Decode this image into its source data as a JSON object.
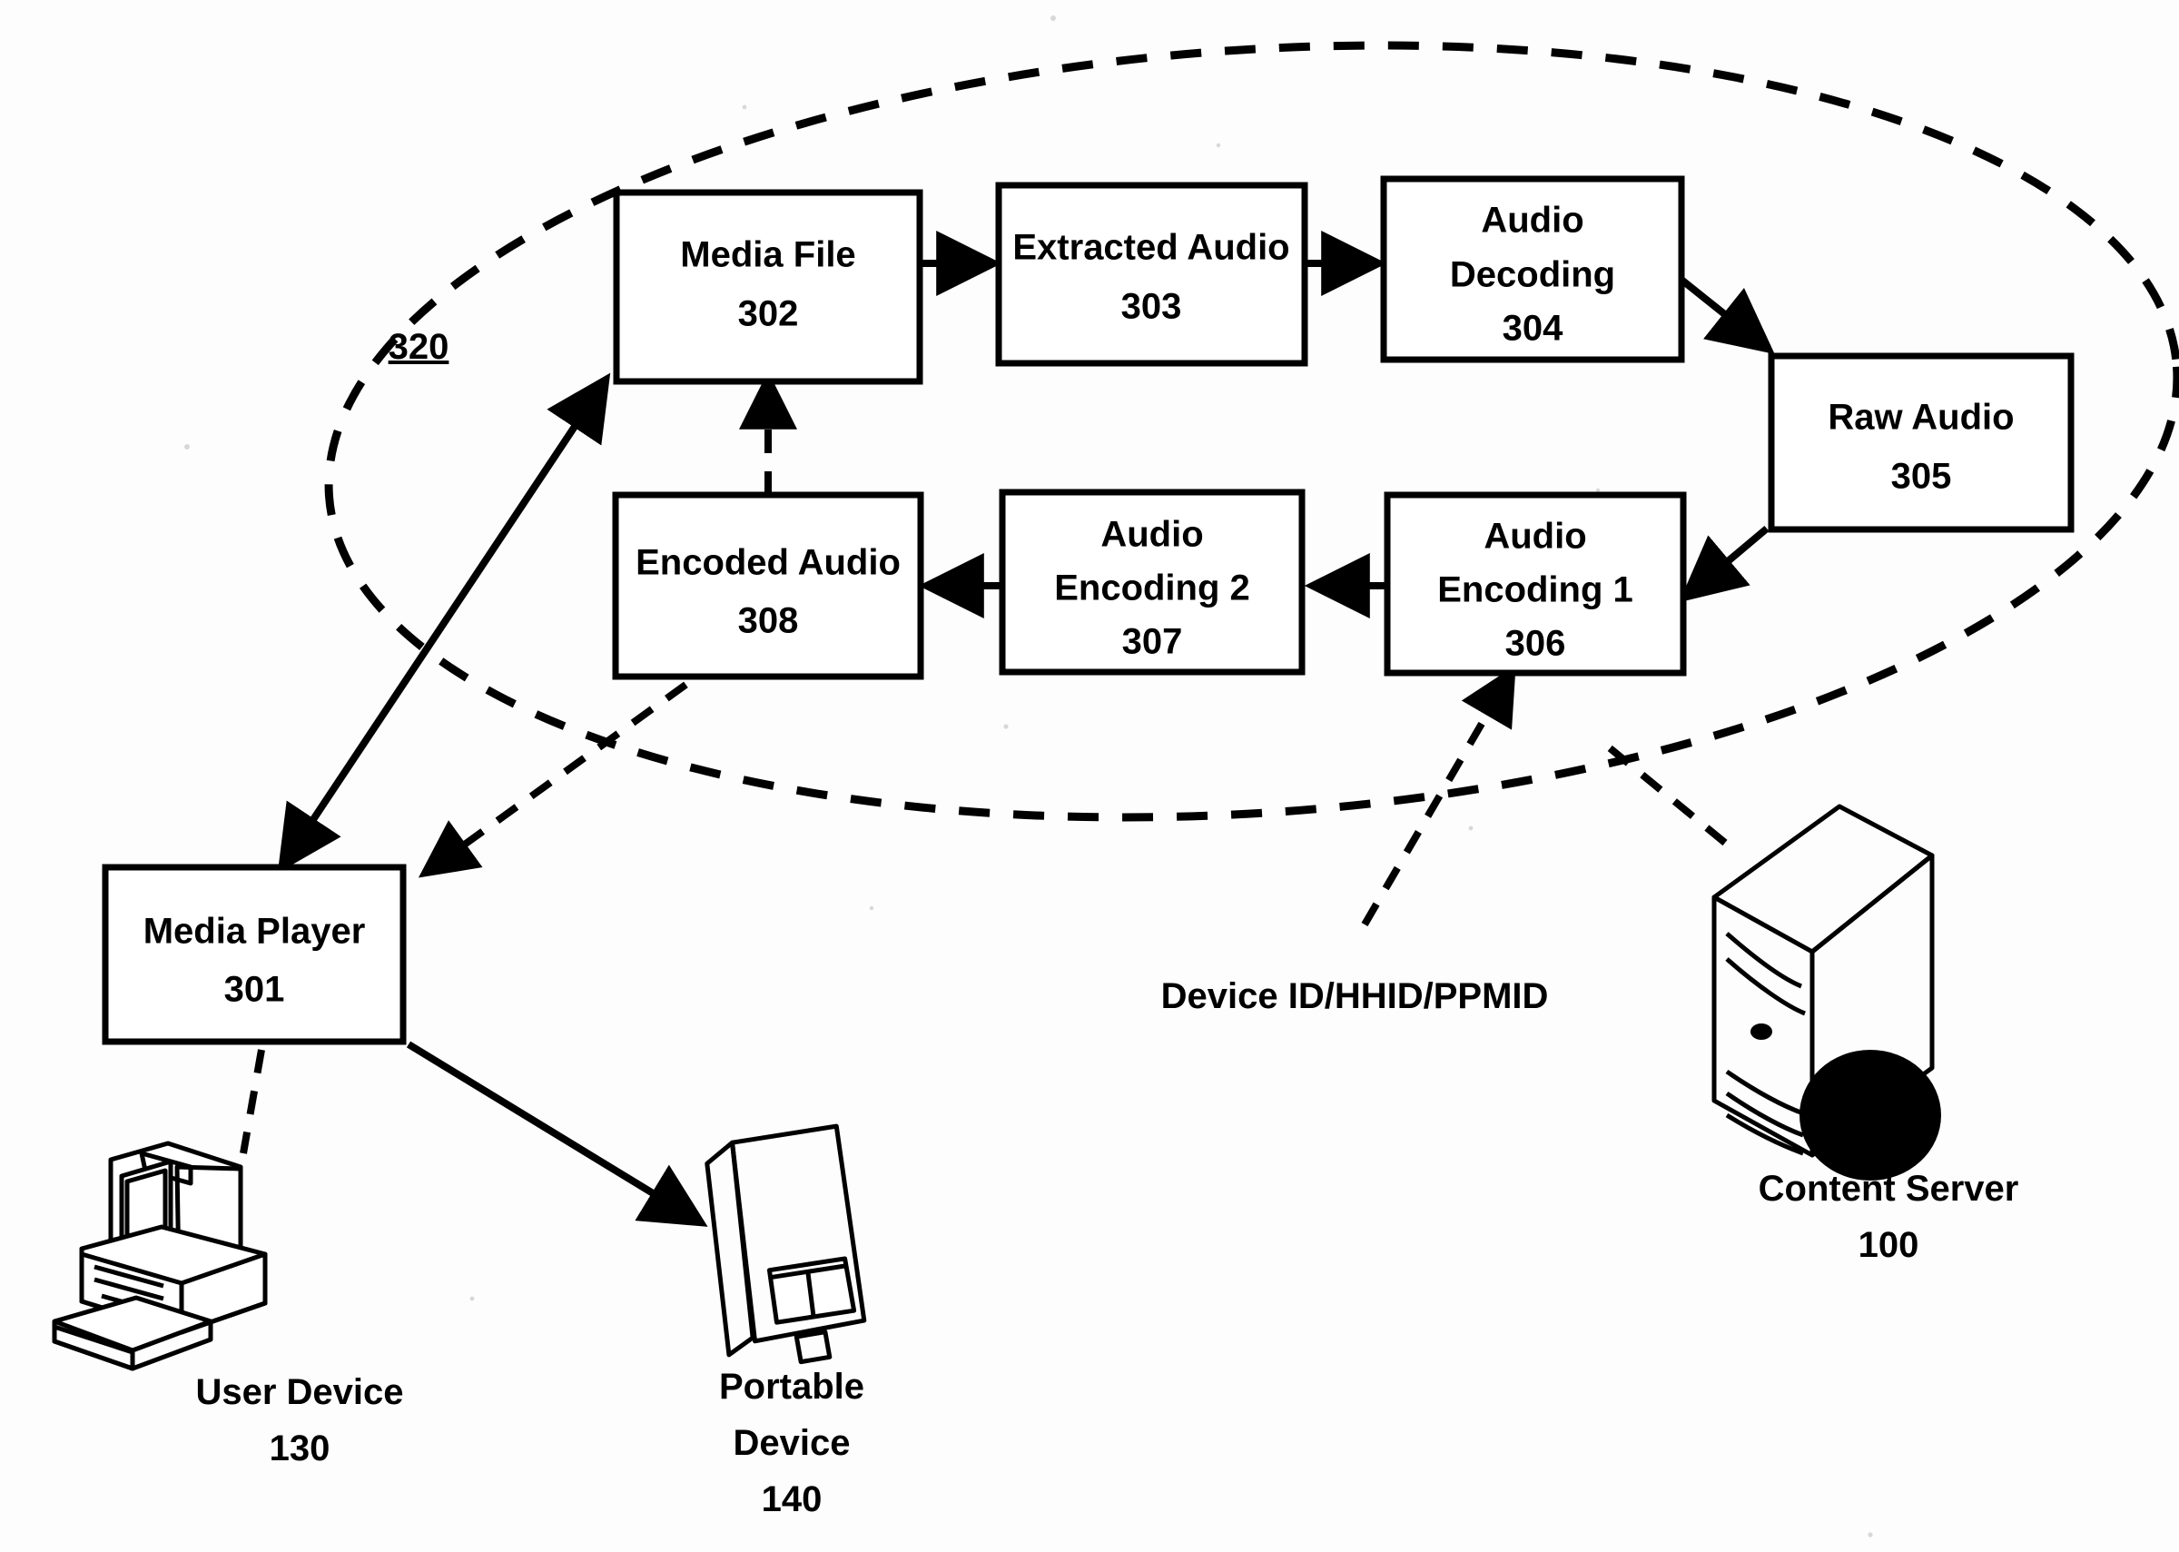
{
  "figure": {
    "type": "patent-flow-diagram",
    "group_label": "320"
  },
  "boxes": [
    {
      "id": "302",
      "lines": [
        "Media File",
        "302"
      ],
      "title": "Media File",
      "number": "302"
    },
    {
      "id": "303",
      "lines": [
        "Extracted Audio",
        "303"
      ],
      "title": "Extracted Audio",
      "number": "303"
    },
    {
      "id": "304",
      "lines": [
        "Audio",
        "Decoding",
        "304"
      ],
      "title": "Audio Decoding",
      "number": "304"
    },
    {
      "id": "305",
      "lines": [
        "Raw Audio",
        "305"
      ],
      "title": "Raw Audio",
      "number": "305"
    },
    {
      "id": "306",
      "lines": [
        "Audio",
        "Encoding 1",
        "306"
      ],
      "title": "Audio Encoding 1",
      "number": "306"
    },
    {
      "id": "307",
      "lines": [
        "Audio",
        "Encoding 2",
        "307"
      ],
      "title": "Audio Encoding 2",
      "number": "307"
    },
    {
      "id": "308",
      "lines": [
        "Encoded Audio",
        "308"
      ],
      "title": "Encoded Audio",
      "number": "308"
    },
    {
      "id": "301",
      "lines": [
        "Media Player",
        "301"
      ],
      "title": "Media Player",
      "number": "301"
    }
  ],
  "box_text": {
    "media_file_title": "Media File",
    "media_file_num": "302",
    "extracted_audio_title": "Extracted Audio",
    "extracted_audio_num": "303",
    "audio_decoding_l1": "Audio",
    "audio_decoding_l2": "Decoding",
    "audio_decoding_num": "304",
    "raw_audio_title": "Raw Audio",
    "raw_audio_num": "305",
    "audio_encoding1_l1": "Audio",
    "audio_encoding1_l2": "Encoding 1",
    "audio_encoding1_num": "306",
    "audio_encoding2_l1": "Audio",
    "audio_encoding2_l2": "Encoding 2",
    "audio_encoding2_num": "307",
    "encoded_audio_title": "Encoded Audio",
    "encoded_audio_num": "308",
    "media_player_title": "Media Player",
    "media_player_num": "301"
  },
  "annotations": {
    "group_ref": "320",
    "device_id_label": "Device ID/HHID/PPMID"
  },
  "devices": [
    {
      "id": "user-device",
      "icon": "desktop-computer-icon",
      "label_line1": "User Device",
      "label_line2": "130"
    },
    {
      "id": "portable-device",
      "icon": "portable-media-player-icon",
      "label_line1": "Portable",
      "label_line2": "Device",
      "label_line3": "140"
    },
    {
      "id": "content-server",
      "icon": "server-tower-icon",
      "label_line1": "Content Server",
      "label_line2": "100"
    }
  ],
  "device_text": {
    "user_device_l1": "User Device",
    "user_device_l2": "130",
    "portable_device_l1": "Portable",
    "portable_device_l2": "Device",
    "portable_device_l3": "140",
    "content_server_l1": "Content Server",
    "content_server_l2": "100"
  },
  "connections": [
    {
      "from": "302",
      "to": "303",
      "style": "solid",
      "arrow": "single"
    },
    {
      "from": "303",
      "to": "304",
      "style": "solid",
      "arrow": "single"
    },
    {
      "from": "304",
      "to": "305",
      "style": "solid",
      "arrow": "single"
    },
    {
      "from": "305",
      "to": "306",
      "style": "solid",
      "arrow": "single"
    },
    {
      "from": "306",
      "to": "307",
      "style": "solid",
      "arrow": "single"
    },
    {
      "from": "307",
      "to": "308",
      "style": "solid",
      "arrow": "single"
    },
    {
      "from": "308",
      "to": "302",
      "style": "dashed",
      "arrow": "single"
    },
    {
      "from": "301",
      "to": "302",
      "style": "solid",
      "arrow": "double"
    },
    {
      "from": "308",
      "to": "301",
      "style": "dashed",
      "arrow": "single"
    },
    {
      "from": "301",
      "to": "user-device",
      "style": "dashed",
      "arrow": "none"
    },
    {
      "from": "301",
      "to": "portable-device",
      "style": "solid",
      "arrow": "single"
    },
    {
      "from": "device-id-label",
      "to": "306",
      "style": "dashed",
      "arrow": "single"
    },
    {
      "from": "content-server",
      "to": "ellipse-320",
      "style": "dashed",
      "arrow": "none"
    }
  ],
  "colors": {
    "line": "#000000",
    "box_fill": "#ffffff",
    "background": "#ffffff"
  }
}
